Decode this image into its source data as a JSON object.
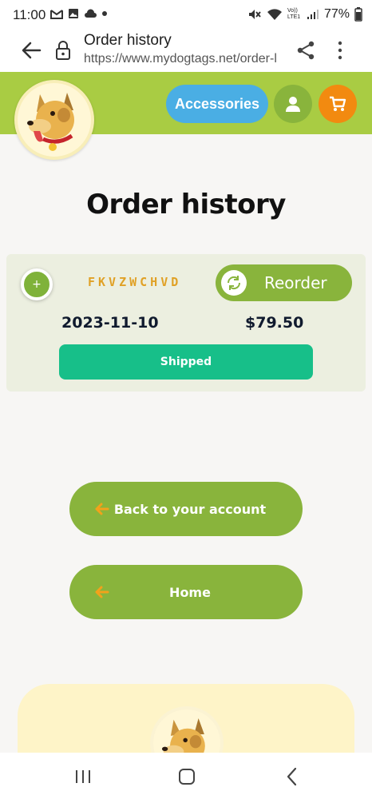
{
  "status_bar": {
    "time": "11:00",
    "battery": "77%",
    "left_icons": [
      "gmail-icon",
      "gallery-icon",
      "cloud-icon",
      "dot-icon"
    ],
    "right_icons": [
      "mute-icon",
      "wifi-icon",
      "volte-icon",
      "signal-icon"
    ],
    "volte_label": "Vo)) LTE1"
  },
  "browser": {
    "title": "Order history",
    "url": "https://www.mydogtags.net/order-l"
  },
  "header": {
    "accessories_label": "Accessories",
    "colors": {
      "bar": "#a9cc43",
      "accessories": "#4aaee4",
      "account": "#89b43c",
      "cart": "#f28a10"
    }
  },
  "page": {
    "title": "Order history"
  },
  "order": {
    "expand_label": "+",
    "code": "FKVZWCHVD",
    "reorder_label": "Reorder",
    "date": "2023-11-10",
    "total": "$79.50",
    "status": "Shipped",
    "status_color": "#17bf89"
  },
  "actions": {
    "back_account_label": "Back to your account",
    "home_label": "Home"
  },
  "android_nav": {
    "items": [
      "recents-icon",
      "home-icon",
      "back-icon"
    ]
  }
}
